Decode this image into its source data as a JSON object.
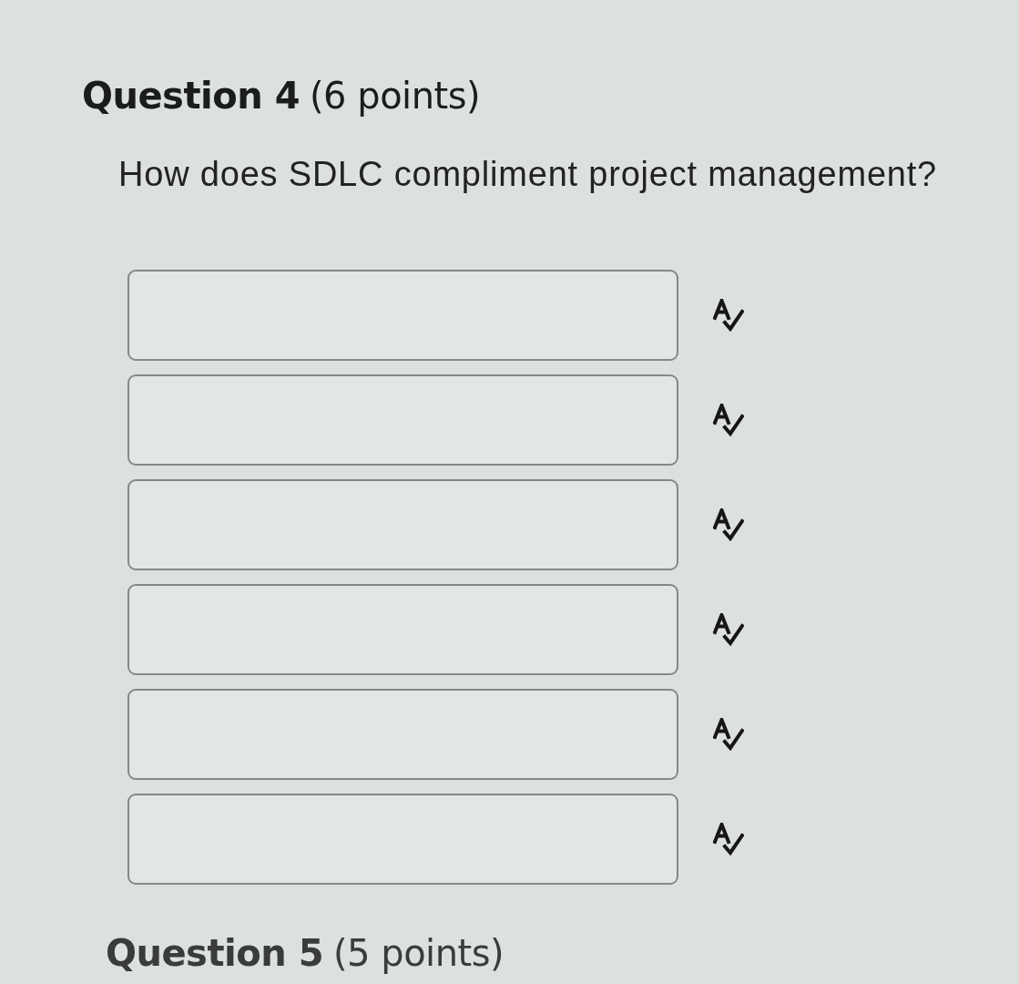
{
  "questions": [
    {
      "title": "Question 4",
      "points": "(6 points)",
      "prompt": "How does SDLC compliment project management?",
      "answer_fields": [
        {
          "spellcheck": true
        },
        {
          "spellcheck": true
        },
        {
          "spellcheck": true
        },
        {
          "spellcheck": true
        },
        {
          "spellcheck": true
        },
        {
          "spellcheck": true
        }
      ]
    },
    {
      "title": "Question 5",
      "points": "(5 points)"
    }
  ]
}
